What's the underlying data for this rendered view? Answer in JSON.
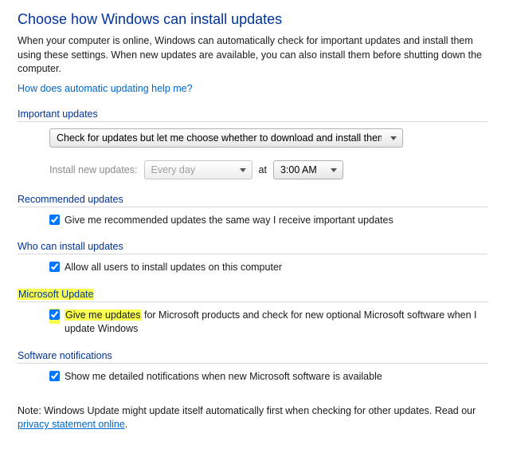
{
  "title": "Choose how Windows can install updates",
  "intro": "When your computer is online, Windows can automatically check for important updates and install them using these settings. When new updates are available, you can also install them before shutting down the computer.",
  "help_link": "How does automatic updating help me?",
  "sections": {
    "important": {
      "header": "Important updates",
      "select_value": "Check for updates but let me choose whether to download and install them",
      "schedule_label": "Install new updates:",
      "schedule_day": "Every day",
      "schedule_at": "at",
      "schedule_time": "3:00 AM"
    },
    "recommended": {
      "header": "Recommended updates",
      "checkbox": "Give me recommended updates the same way I receive important updates"
    },
    "who": {
      "header": "Who can install updates",
      "checkbox": "Allow all users to install updates on this computer"
    },
    "msupdate": {
      "header": "Microsoft Update",
      "checkbox": "Give me updates for Microsoft products and check for new optional Microsoft software when I update Windows"
    },
    "notifications": {
      "header": "Software notifications",
      "checkbox": "Show me detailed notifications when new Microsoft software is available"
    }
  },
  "note_prefix": "Note: Windows Update might update itself automatically first when checking for other updates.  Read our ",
  "note_link": "privacy statement online",
  "note_suffix": "."
}
